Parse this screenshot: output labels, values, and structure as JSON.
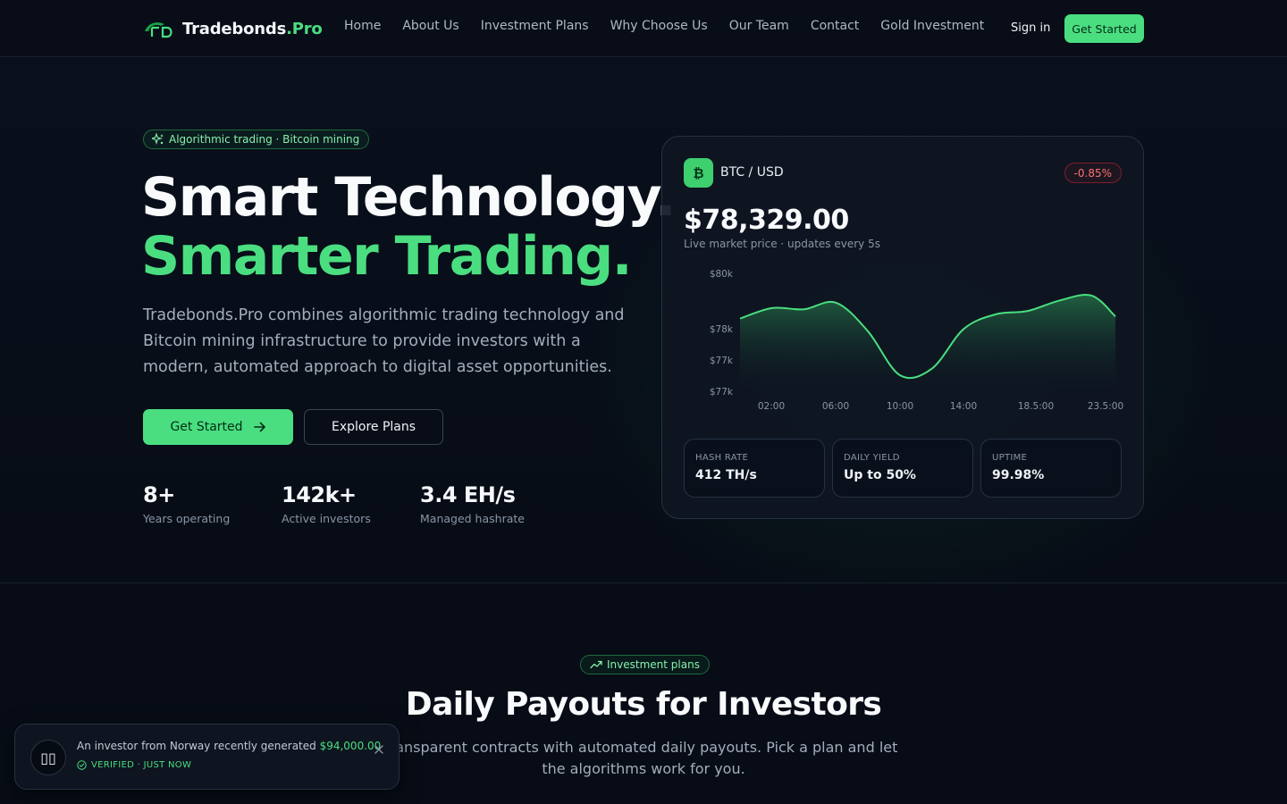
{
  "nav": {
    "brand_main": "Tradebonds",
    "brand_accent": ".Pro",
    "links": [
      "Home",
      "About Us",
      "Investment Plans",
      "Why Choose Us",
      "Our Team",
      "Contact",
      "Gold Investment"
    ],
    "sign_in": "Sign in",
    "cta": "Get Started"
  },
  "hero": {
    "badge": "Algorithmic trading · Bitcoin mining",
    "title_line1": "Smart Technology.",
    "title_line2": "Smarter Trading.",
    "description": "Tradebonds.Pro combines algorithmic trading technology and Bitcoin mining infrastructure to provide investors with a modern, automated approach to digital asset opportunities.",
    "primary_button": "Get Started",
    "secondary_button": "Explore Plans",
    "stats": [
      {
        "value": "8+",
        "label": "Years operating"
      },
      {
        "value": "142k+",
        "label": "Active investors"
      },
      {
        "value": "3.4 EH/s",
        "label": "Managed hashrate"
      }
    ]
  },
  "ticker": {
    "coin_symbol": "₿",
    "pair": "BTC / USD",
    "change": "-0.85%",
    "price": "$78,329.00",
    "subtitle": "Live market price · updates every 5s",
    "metrics": [
      {
        "label": "HASH RATE",
        "value": "412 TH/s"
      },
      {
        "label": "DAILY YIELD",
        "value": "Up to 50%"
      },
      {
        "label": "UPTIME",
        "value": "99.98%"
      }
    ]
  },
  "chart_data": {
    "type": "area",
    "x_tick_labels": [
      "02:00",
      "06:00",
      "10:00",
      "14:00",
      "18.5:00",
      "23.5:00"
    ],
    "y_tick_labels": [
      "$80k",
      "$78k",
      "$77k",
      "$77k"
    ],
    "x": [
      0,
      2,
      4,
      6,
      8,
      10,
      12,
      14,
      16,
      18,
      20,
      22,
      23.5
    ],
    "y": [
      78900,
      79150,
      79120,
      79280,
      78600,
      77550,
      77700,
      78650,
      79000,
      79080,
      79330,
      79450,
      78950
    ],
    "ylim": [
      77100,
      80000
    ],
    "colors": {
      "line": "#4ade80",
      "fill_top": "#2f9e5a",
      "fill_bottom": "#0f1622"
    }
  },
  "section": {
    "badge": "Investment plans",
    "title": "Daily Payouts for Investors",
    "subtitle": "ransparent contracts with automated daily payouts. Pick a plan and let the algorithms work for you."
  },
  "toast": {
    "avatar": "▯▯",
    "text": "An investor from Norway recently generated ",
    "amount": "$94,000.00",
    "meta": "VERIFIED · JUST NOW"
  },
  "colors": {
    "accent": "#4ade80",
    "background": "#070c16",
    "negative": "#f87171"
  }
}
